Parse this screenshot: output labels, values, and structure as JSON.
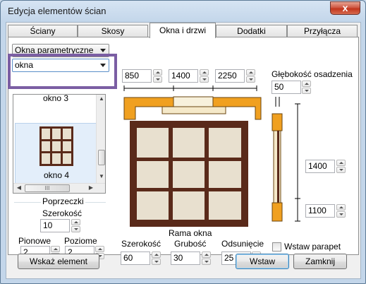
{
  "window": {
    "title": "Edycja elementów ścian",
    "close_glyph": "x"
  },
  "tabs": [
    {
      "label": "Ściany",
      "active": false
    },
    {
      "label": "Skosy",
      "active": false
    },
    {
      "label": "Okna i drzwi",
      "active": true
    },
    {
      "label": "Dodatki",
      "active": false
    },
    {
      "label": "Przyłącza",
      "active": false
    }
  ],
  "selectors": {
    "category": "Okna parametryczne",
    "type": "okna"
  },
  "element_list": {
    "items": [
      {
        "label": "okno 3"
      },
      {
        "label": "okno 4"
      }
    ],
    "selected": "okno 4",
    "hscroll_glyph": "III"
  },
  "top_widths": [
    "850",
    "1400",
    "2250"
  ],
  "depth": {
    "label": "Głębokość osadzenia",
    "value": "50"
  },
  "right_dims": [
    "1400",
    "1100"
  ],
  "mullions": {
    "group_label": "Poprzeczki",
    "width_label": "Szerokość",
    "width_value": "10",
    "vertical_label": "Pionowe",
    "vertical_value": "2",
    "horizontal_label": "Poziome",
    "horizontal_value": "2"
  },
  "frame": {
    "group_label": "Rama okna",
    "width_label": "Szerokość",
    "width_value": "60",
    "thickness_label": "Grubość",
    "thickness_value": "30",
    "offset_label": "Odsunięcie",
    "offset_value": "25"
  },
  "parapet": {
    "label": "Wstaw parapet",
    "checked": false
  },
  "buttons": {
    "show_element": "Wskaż element",
    "insert": "Wstaw",
    "close": "Zamknij"
  },
  "colors": {
    "frame_brown": "#5a2a1a",
    "glass": "#e8e0cf",
    "wall_orange": "#f0a020",
    "accent": "#7b5ea3"
  }
}
